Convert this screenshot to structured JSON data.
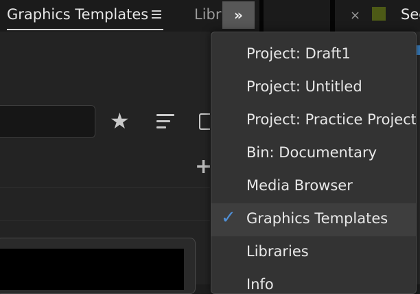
{
  "tabbar": {
    "graphics_tab": "Graphics Templates",
    "libraries_tab": "Libra",
    "overflow_label": "»",
    "close_label": "×",
    "seq_tab": "Sec",
    "swatch_color": "#4d5a16"
  },
  "left_panel": {
    "star_icon": "★",
    "plus_icon": "+"
  },
  "menu": {
    "items": [
      {
        "label": "Project: Draft1",
        "checked": false
      },
      {
        "label": "Project: Untitled",
        "checked": false
      },
      {
        "label": "Project: Practice Project",
        "checked": false
      },
      {
        "label": "Bin: Documentary",
        "checked": false
      },
      {
        "label": "Media Browser",
        "checked": false
      },
      {
        "label": "Graphics Templates",
        "checked": true
      },
      {
        "label": "Libraries",
        "checked": false
      },
      {
        "label": "Info",
        "checked": false
      }
    ],
    "check_glyph": "✓",
    "accent_color": "#4f8fd6"
  }
}
